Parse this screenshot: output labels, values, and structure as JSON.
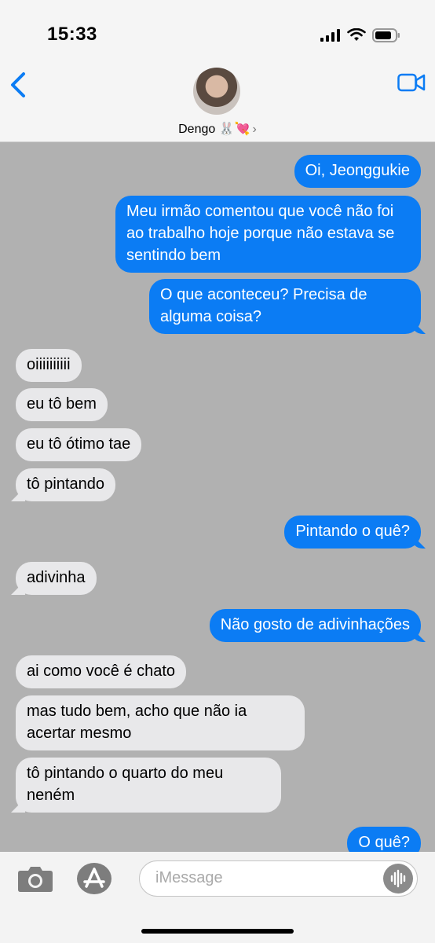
{
  "status_bar": {
    "time": "15:33"
  },
  "header": {
    "contact_name": "Dengo 🐰💘",
    "chevron": "›"
  },
  "messages": [
    {
      "side": "out",
      "text": "Oi, Jeonggukie"
    },
    {
      "side": "out",
      "text": "Meu irmão comentou que você não foi ao trabalho hoje porque não estava se sentindo bem"
    },
    {
      "side": "out",
      "text": "O que aconteceu? Precisa de alguma coisa?"
    },
    {
      "side": "in",
      "text": "oiiiiiiiiii"
    },
    {
      "side": "in",
      "text": "eu tô bem"
    },
    {
      "side": "in",
      "text": "eu tô ótimo tae"
    },
    {
      "side": "in",
      "text": "tô pintando"
    },
    {
      "side": "out",
      "text": "Pintando o quê?"
    },
    {
      "side": "in",
      "text": "adivinha"
    },
    {
      "side": "out",
      "text": "Não gosto de adivinhações"
    },
    {
      "side": "in",
      "text": "ai como você é chato"
    },
    {
      "side": "in",
      "text": "mas tudo bem, acho que não ia acertar mesmo"
    },
    {
      "side": "in",
      "text": "tô pintando o quarto do meu neném"
    },
    {
      "side": "out",
      "text": "O quê?"
    }
  ],
  "composer": {
    "placeholder": "iMessage"
  },
  "icons": {
    "back": "chevron-left-icon",
    "video": "video-camera-icon",
    "camera": "camera-icon",
    "apps": "app-store-icon",
    "audio": "audio-waveform-icon"
  },
  "colors": {
    "outgoing_bubble": "#0b7cf4",
    "incoming_bubble": "#e8e8ea",
    "background": "#b1b1b1",
    "accent": "#0b7cf4"
  }
}
